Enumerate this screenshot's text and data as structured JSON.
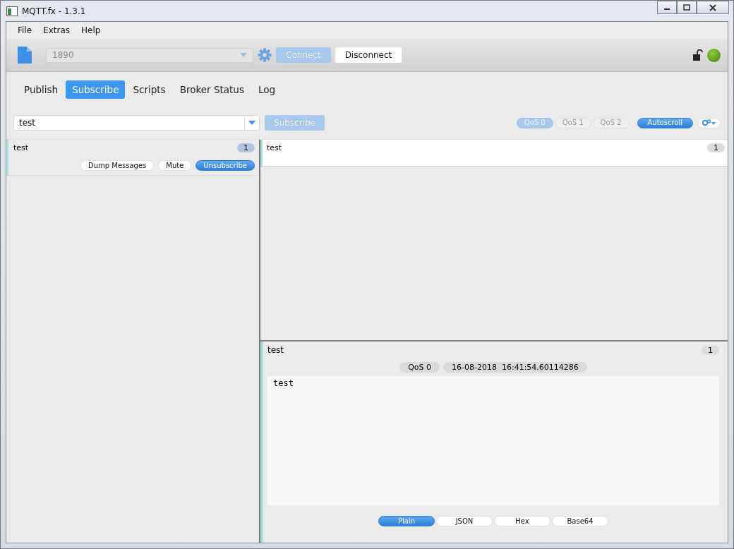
{
  "window": {
    "title": "MQTT.fx - 1.3.1"
  },
  "menu": [
    "File",
    "Extras",
    "Help"
  ],
  "toolbar": {
    "profile": "1890",
    "connect": {
      "label": "Connect",
      "disabled": true
    },
    "disconnect": {
      "label": "Disconnect",
      "disabled": false
    },
    "connected": true
  },
  "tabs": [
    {
      "label": "Publish",
      "selected": false
    },
    {
      "label": "Subscribe",
      "selected": true
    },
    {
      "label": "Scripts",
      "selected": false
    },
    {
      "label": "Broker Status",
      "selected": false
    },
    {
      "label": "Log",
      "selected": false
    }
  ],
  "subscribe_bar": {
    "topic": "test",
    "button": {
      "label": "Subscribe",
      "disabled": true
    },
    "qos": [
      {
        "label": "QoS 0",
        "selected": true
      },
      {
        "label": "QoS 1",
        "selected": false
      },
      {
        "label": "QoS 2",
        "selected": false
      }
    ],
    "autoscroll": {
      "label": "Autoscroll",
      "on": true
    }
  },
  "subscriptions": [
    {
      "topic": "test",
      "count": "1",
      "buttons": [
        {
          "label": "Dump Messages",
          "kind": "plain"
        },
        {
          "label": "Mute",
          "kind": "plain"
        },
        {
          "label": "Unsubscribe",
          "kind": "primary"
        }
      ]
    }
  ],
  "messages": [
    {
      "topic": "test",
      "count": "1"
    }
  ],
  "detail": {
    "topic": "test",
    "count": "1",
    "qos": "QoS 0",
    "timestamp": "16-08-2018  16:41:54.60114286",
    "payload": "test",
    "formats": [
      {
        "label": "Plain",
        "selected": true
      },
      {
        "label": "JSON",
        "selected": false
      },
      {
        "label": "Hex",
        "selected": false
      },
      {
        "label": "Base64",
        "selected": false
      }
    ]
  }
}
